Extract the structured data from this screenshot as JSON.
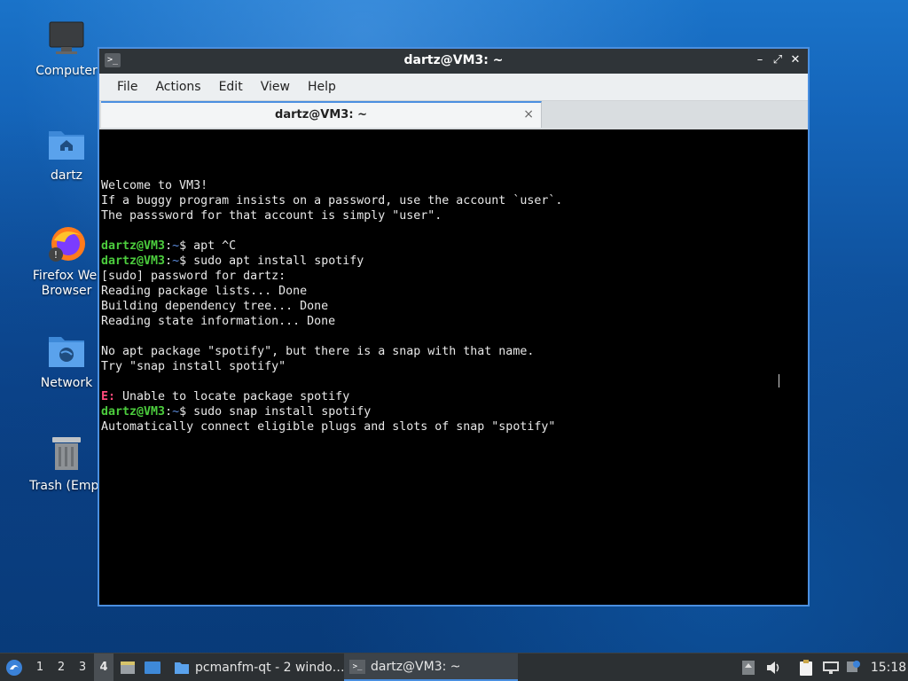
{
  "desktop": {
    "icons": [
      {
        "label": "Computer",
        "icon": "monitor-icon"
      },
      {
        "label": "dartz",
        "icon": "home-folder-icon"
      },
      {
        "label_line1": "Firefox Wel",
        "label_line2": "Browser",
        "icon": "firefox-icon"
      },
      {
        "label": "Network",
        "icon": "network-folder-icon"
      },
      {
        "label": "Trash (Empt",
        "icon": "trash-icon"
      }
    ]
  },
  "window": {
    "title": "dartz@VM3: ~",
    "menu": [
      "File",
      "Actions",
      "Edit",
      "View",
      "Help"
    ],
    "tab_label": "dartz@VM3: ~",
    "tab_close": "×",
    "controls": {
      "minimize": "–",
      "maximize": "⤢",
      "close": "✕"
    }
  },
  "terminal": {
    "lines": [
      {
        "text": "Welcome to VM3!"
      },
      {
        "text": "If a buggy program insists on a password, use the account `user`."
      },
      {
        "text": "The passsword for that account is simply \"user\"."
      },
      {
        "text": ""
      },
      {
        "user": "dartz@VM3",
        "sep": ":",
        "dir": "~",
        "cmd": "$ apt ^C"
      },
      {
        "user": "dartz@VM3",
        "sep": ":",
        "dir": "~",
        "cmd": "$ sudo apt install spotify"
      },
      {
        "text": "[sudo] password for dartz:"
      },
      {
        "text": "Reading package lists... Done"
      },
      {
        "text": "Building dependency tree... Done"
      },
      {
        "text": "Reading state information... Done"
      },
      {
        "text": ""
      },
      {
        "text": "No apt package \"spotify\", but there is a snap with that name."
      },
      {
        "text": "Try \"snap install spotify\""
      },
      {
        "text": ""
      },
      {
        "err": "E:",
        "text": " Unable to locate package spotify"
      },
      {
        "user": "dartz@VM3",
        "sep": ":",
        "dir": "~",
        "cmd": "$ sudo snap install spotify"
      },
      {
        "text": "Automatically connect eligible plugs and slots of snap \"spotify\""
      }
    ]
  },
  "taskbar": {
    "workspaces": [
      "1",
      "2",
      "3",
      "4"
    ],
    "active_workspace": "4",
    "tasks": [
      {
        "label": "pcmanfm-qt - 2 windo…",
        "icon": "folder-icon"
      },
      {
        "label": "dartz@VM3: ~",
        "icon": "terminal-icon"
      }
    ],
    "clock": "15:18"
  },
  "colors": {
    "accent": "#4a8fe0",
    "prompt_user": "#4ccd3d",
    "prompt_dir": "#5d8ee0",
    "error": "#ff4a7a"
  }
}
